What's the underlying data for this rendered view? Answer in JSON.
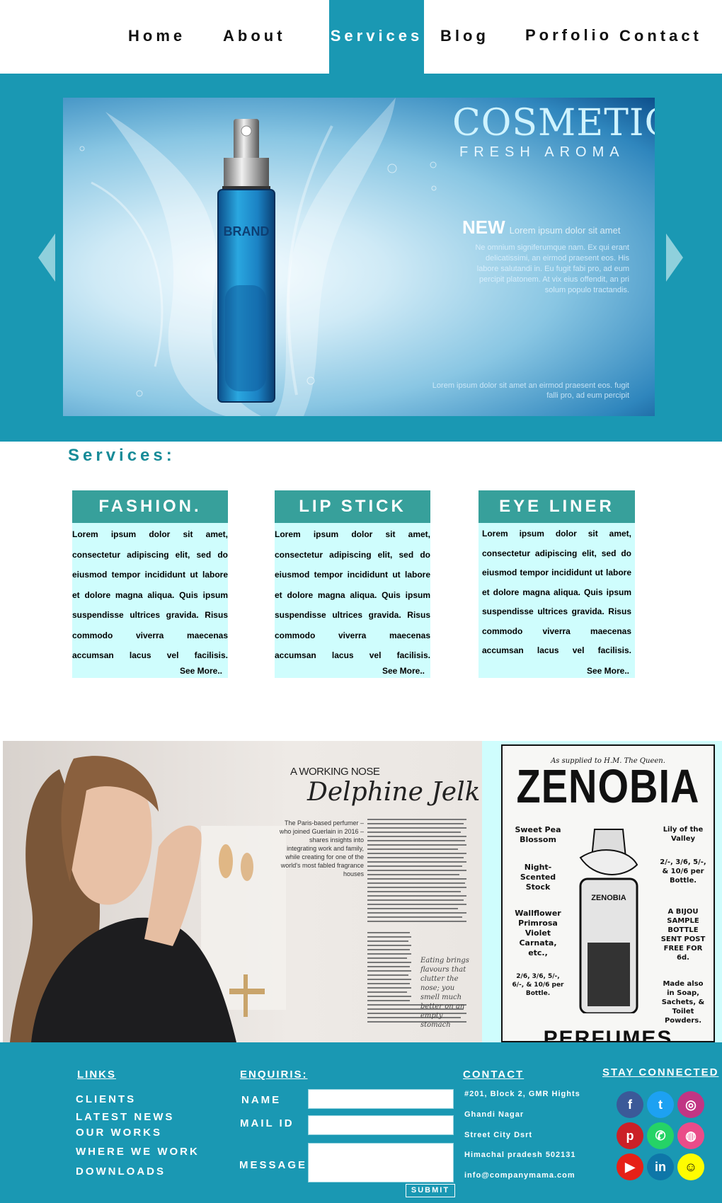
{
  "nav": {
    "items": [
      {
        "label": "Home"
      },
      {
        "label": "About"
      },
      {
        "label": "Services"
      },
      {
        "label": "Blog"
      },
      {
        "label": "Porfolio"
      },
      {
        "label": "Contact"
      }
    ],
    "active": "Services"
  },
  "hero": {
    "title": "COSMETIC",
    "subtitle": "FRESH AROMA",
    "new_label": "NEW",
    "new_text": "Lorem ipsum dolor sit amet",
    "paragraph": "Ne omnium signiferumque nam. Ex qui erant delicatissimi, an eirmod praesent eos. His labore salutandi in. Eu fugit fabi pro, ad eum percipit platonem. At vix eius offendit, an pri solum populo tractandis.",
    "footer_text": "Lorem ipsum dolor sit amet an eirmod praesent eos. fugit falli pro, ad eum percipit",
    "bottle_brand": "BRAND"
  },
  "services": {
    "title": "Services:",
    "cards": [
      {
        "title": "FASHION.",
        "text": "Lorem ipsum dolor sit amet, consectetur adipiscing elit, sed do eiusmod tempor incididunt ut labore et dolore magna aliqua. Quis ipsum suspendisse ultrices gravida. Risus commodo viverra maecenas accumsan lacus vel facilisis.",
        "more": "See More.."
      },
      {
        "title": "LIP STICK",
        "text": "Lorem ipsum dolor sit amet, consectetur adipiscing elit, sed do eiusmod tempor incididunt ut labore et dolore magna aliqua. Quis ipsum suspendisse ultrices gravida. Risus commodo viverra maecenas accumsan lacus vel facilisis.",
        "more": "See More.."
      },
      {
        "title": "EYE LINER",
        "text": "Lorem ipsum dolor sit amet, consectetur adipiscing elit, sed do eiusmod tempor incididunt ut labore et dolore magna aliqua. Quis ipsum suspendisse ultrices gravida. Risus commodo viverra maecenas accumsan lacus vel facilisis.",
        "more": "See More.."
      }
    ]
  },
  "gallery": {
    "magazine": {
      "kicker": "A WORKING NOSE",
      "name": "Delphine Jelk",
      "lead": "The Paris-based perfumer – who joined Guerlain in 2016 – shares insights into integrating work and family, while creating for one of the world's most fabled fragrance houses",
      "pull_quote": "Eating brings flavours that clutter the nose; you smell much better on an empty stomach"
    },
    "ad": {
      "top": "As supplied to H.M. The Queen.",
      "title": "ZENOBIA",
      "left1": "Sweet Pea Blossom",
      "left2": "Night-Scented Stock",
      "left3": "Wallflower Primrosa Violet Carnata, etc.,",
      "left4": "2/6, 3/6, 5/-, 6/-, & 10/6 per Bottle.",
      "right1": "Lily of the Valley",
      "right2": "2/-, 3/6, 5/-, & 10/6 per Bottle.",
      "right3": "A BIJOU SAMPLE BOTTLE SENT POST FREE FOR 6d.",
      "right4": "Made also in Soap, Sachets, & Toilet Powders.",
      "bottle_label": "ZENOBIA",
      "bottom": "PERFUMES"
    }
  },
  "footer": {
    "links_title": "LINKS",
    "links": [
      "CLIENTS",
      "LATEST NEWS",
      "OUR WORKS",
      "WHERE WE WORK",
      "DOWNLOADS"
    ],
    "enquiry_title": "ENQUIRIS:",
    "name_label": "NAME",
    "mail_label": "MAIL ID",
    "message_label": "MESSAGE",
    "submit_label": "SUBMIT",
    "contact_title": "CONTACT",
    "contact_lines": [
      "#201, Block 2, GMR Hights",
      "Ghandi Nagar",
      "Street City Dsrt",
      "Himachal pradesh 502131",
      "info@companymama.com"
    ],
    "stay_title": "STAY CONNECTED",
    "social": [
      {
        "name": "facebook-icon",
        "glyph": "f",
        "color": "#3b5998"
      },
      {
        "name": "twitter-icon",
        "glyph": "t",
        "color": "#1da1f2"
      },
      {
        "name": "instagram-icon",
        "glyph": "◎",
        "color": "#c13584"
      },
      {
        "name": "pinterest-icon",
        "glyph": "p",
        "color": "#cb2027"
      },
      {
        "name": "whatsapp-icon",
        "glyph": "✆",
        "color": "#25d366"
      },
      {
        "name": "dribbble-icon",
        "glyph": "◍",
        "color": "#ea4c89"
      },
      {
        "name": "youtube-icon",
        "glyph": "▶",
        "color": "#e62117"
      },
      {
        "name": "linkedin-icon",
        "glyph": "in",
        "color": "#0e76a8"
      },
      {
        "name": "snapchat-icon",
        "glyph": "☺",
        "color": "#fffc00"
      }
    ]
  },
  "colors": {
    "accent": "#1a98b3",
    "card_head": "#37a09b",
    "card_body": "#cffdfd",
    "services_title": "#178b98"
  }
}
